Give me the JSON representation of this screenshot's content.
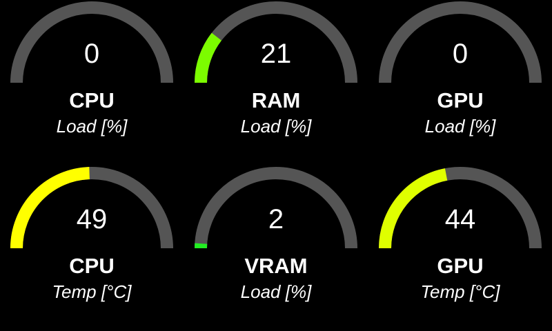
{
  "gauges": [
    {
      "value": "0",
      "name": "CPU",
      "unit": "Load [%]",
      "level_percent": 0,
      "color": "#7cfc00"
    },
    {
      "value": "21",
      "name": "RAM",
      "unit": "Load [%]",
      "level_percent": 21,
      "color": "#7cfc00"
    },
    {
      "value": "0",
      "name": "GPU",
      "unit": "Load [%]",
      "level_percent": 0,
      "color": "#7cfc00"
    },
    {
      "value": "49",
      "name": "CPU",
      "unit": "Temp [°C]",
      "level_percent": 49,
      "color": "#ffff00"
    },
    {
      "value": "2",
      "name": "VRAM",
      "unit": "Load [%]",
      "level_percent": 2,
      "color": "#22ee22"
    },
    {
      "value": "44",
      "name": "GPU",
      "unit": "Temp [°C]",
      "level_percent": 44,
      "color": "#dfff00"
    }
  ],
  "colors": {
    "background": "#000000",
    "track": "#555555",
    "text": "#ffffff"
  }
}
